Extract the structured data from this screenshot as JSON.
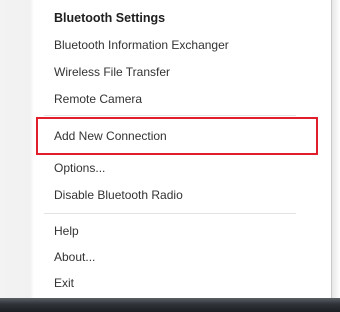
{
  "menu": {
    "items": [
      {
        "label": "Bluetooth Settings"
      },
      {
        "label": "Bluetooth Information Exchanger"
      },
      {
        "label": "Wireless File Transfer"
      },
      {
        "label": "Remote Camera"
      },
      {
        "label": "Add New Connection"
      },
      {
        "label": "Options..."
      },
      {
        "label": "Disable Bluetooth Radio"
      },
      {
        "label": "Help"
      },
      {
        "label": "About..."
      },
      {
        "label": "Exit"
      }
    ]
  },
  "colors": {
    "highlight_border": "#e01e2c",
    "taskbar": "#30343a",
    "menu_background": "#ffffff",
    "text": "#333333"
  }
}
